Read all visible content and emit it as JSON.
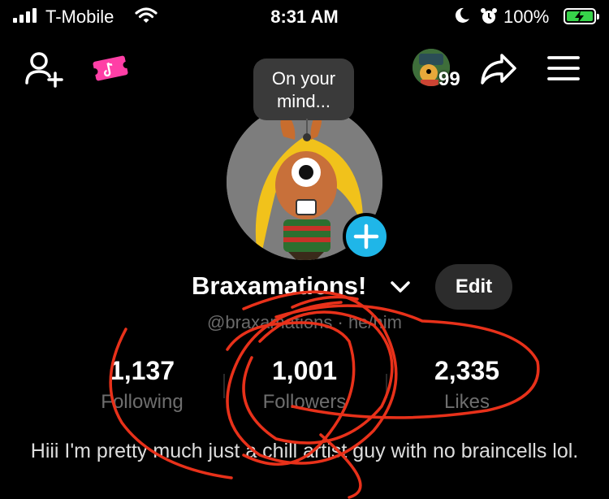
{
  "status_bar": {
    "carrier": "T-Mobile",
    "time": "8:31 AM",
    "battery_percent": "100%",
    "battery_color": "#37d34a"
  },
  "top_nav": {
    "add_friend_icon": "person-plus-icon",
    "ticket_icon": "tiktok-ticket-icon",
    "story_badge": "99",
    "share_icon": "share-arrow-icon",
    "menu_icon": "hamburger-menu-icon"
  },
  "profile": {
    "bubble_text": "On your mind...",
    "display_name": "Braxamations!",
    "edit_label": "Edit",
    "handle": "@braxamations · he/him"
  },
  "stats": [
    {
      "value": "1,137",
      "label": "Following"
    },
    {
      "value": "1,001",
      "label": "Followers"
    },
    {
      "value": "2,335",
      "label": "Likes"
    }
  ],
  "bio": "Hiii I'm pretty much just a chill artist guy with no braincells lol.",
  "colors": {
    "accent_blue": "#1fb6e8",
    "annotation_red": "#e8311a",
    "ticket_pink": "#ff3fa6"
  }
}
